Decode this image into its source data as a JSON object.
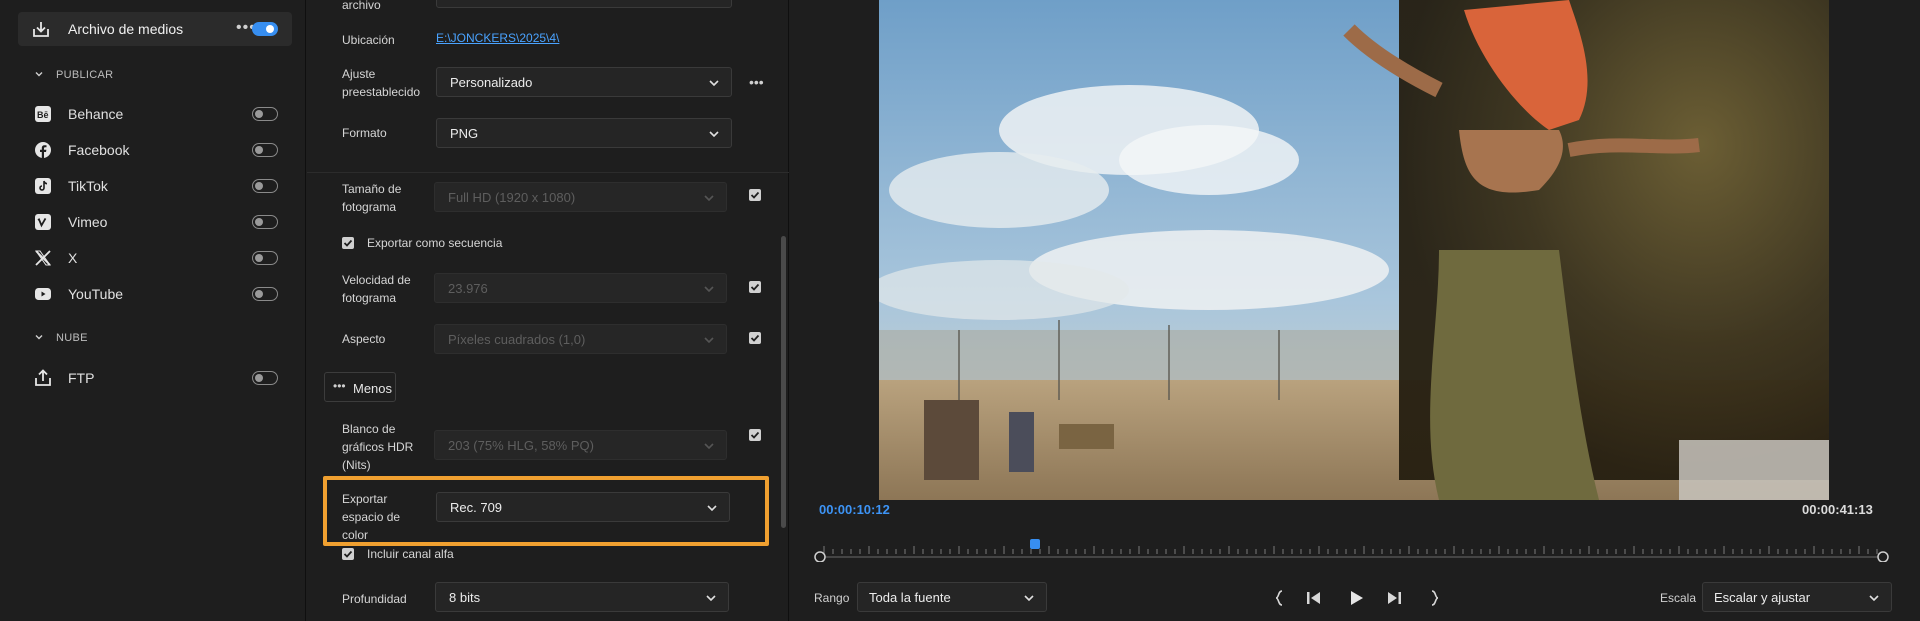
{
  "sidebar": {
    "media": {
      "label": "Archivo de medios",
      "toggle_on": true
    },
    "publicar": {
      "heading": "PUBLICAR",
      "items": [
        {
          "label": "Behance",
          "icon": "behance-icon"
        },
        {
          "label": "Facebook",
          "icon": "facebook-icon"
        },
        {
          "label": "TikTok",
          "icon": "tiktok-icon"
        },
        {
          "label": "Vimeo",
          "icon": "vimeo-icon"
        },
        {
          "label": "X",
          "icon": "x-icon"
        },
        {
          "label": "YouTube",
          "icon": "youtube-icon"
        }
      ]
    },
    "nube": {
      "heading": "NUBE",
      "items": [
        {
          "label": "FTP",
          "icon": "upload-icon"
        }
      ]
    }
  },
  "settings": {
    "archivo_label": "archivo",
    "ubicacion_label": "Ubicación",
    "ubicacion_value": "E:\\JONCKERS\\2025\\4\\",
    "preset_label": "Ajuste preestablecido",
    "preset_value": "Personalizado",
    "formato_label": "Formato",
    "formato_value": "PNG",
    "frame_size_label": "Tamaño de fotograma",
    "frame_size_value": "Full HD (1920 x 1080)",
    "export_seq_label": "Exportar como secuencia",
    "frame_rate_label": "Velocidad de fotograma",
    "frame_rate_value": "23.976",
    "aspect_label": "Aspecto",
    "aspect_value": "Píxeles cuadrados (1,0)",
    "menos_label": "Menos",
    "hdr_label": "Blanco de gráficos HDR (Nits)",
    "hdr_value": "203 (75% HLG, 58% PQ)",
    "color_space_label": "Exportar espacio de color",
    "color_space_value": "Rec. 709",
    "alpha_label": "Incluir canal alfa",
    "depth_label": "Profundidad",
    "depth_value": "8 bits"
  },
  "preview": {
    "current_timecode": "00:00:10:12",
    "end_timecode": "00:00:41:13",
    "playhead_fraction": 0.2,
    "range_label": "Rango",
    "range_value": "Toda la fuente",
    "scale_label": "Escala",
    "scale_value": "Escalar y ajustar"
  },
  "colors": {
    "accent": "#378ef0",
    "highlight": "#f0a030",
    "link": "#4aa3ff"
  }
}
